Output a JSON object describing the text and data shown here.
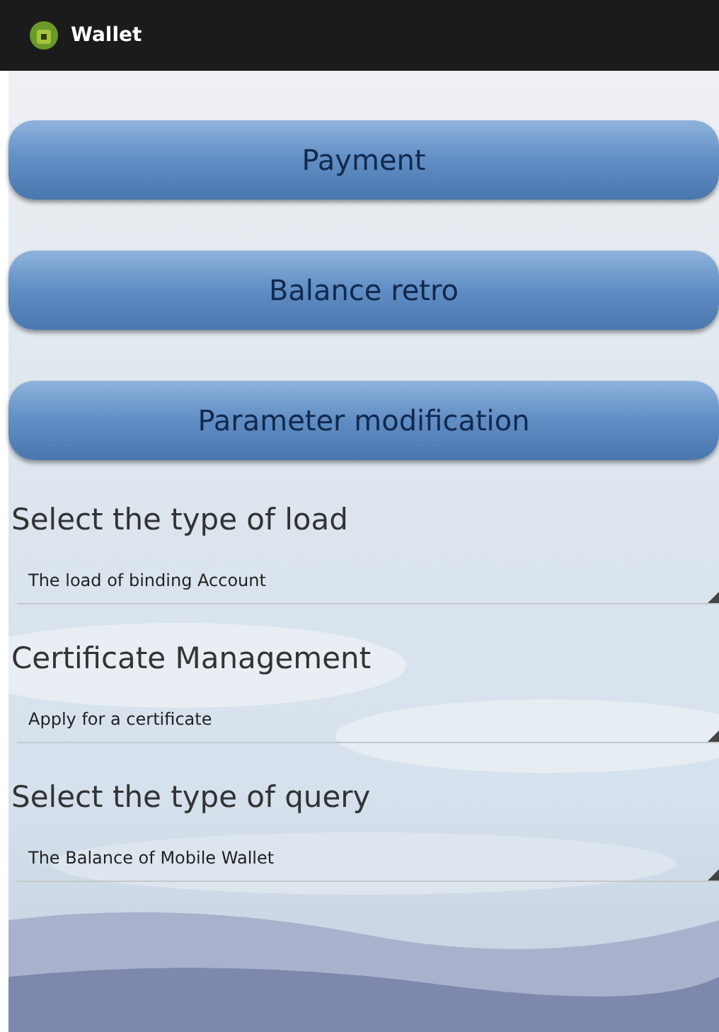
{
  "window": {
    "title": "Wallet"
  },
  "buttons": [
    {
      "label": "Payment"
    },
    {
      "label": "Balance retro"
    },
    {
      "label": "Parameter modification"
    }
  ],
  "sections": [
    {
      "label": "Select the type of load",
      "value": "The load of binding Account"
    },
    {
      "label": "Certificate Management",
      "value": "Apply for a certificate"
    },
    {
      "label": "Select the type of query",
      "value": "The Balance of Mobile Wallet"
    }
  ]
}
